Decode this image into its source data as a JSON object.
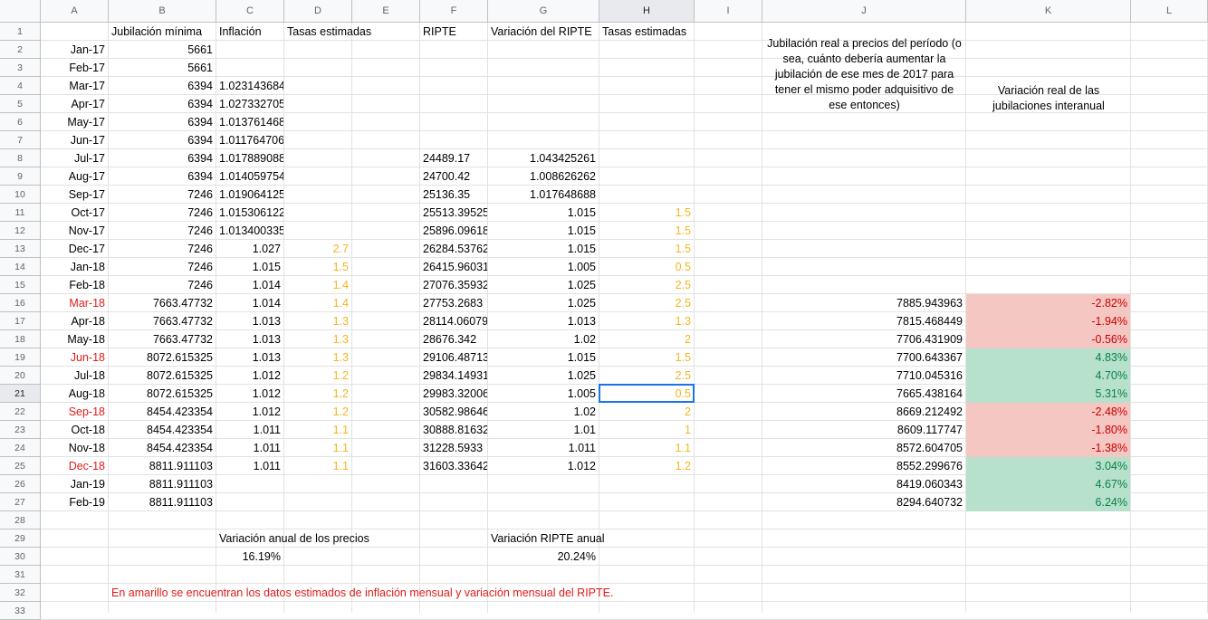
{
  "columns": [
    "A",
    "B",
    "C",
    "D",
    "E",
    "F",
    "G",
    "H",
    "I",
    "J",
    "K",
    "L"
  ],
  "selected_column": "H",
  "selected_row": "21",
  "rows": [
    "1",
    "2",
    "3",
    "4",
    "5",
    "6",
    "7",
    "8",
    "9",
    "10",
    "11",
    "12",
    "13",
    "14",
    "15",
    "16",
    "17",
    "18",
    "19",
    "20",
    "21",
    "22",
    "23",
    "24",
    "25",
    "26",
    "27",
    "28",
    "29",
    "30",
    "31",
    "32",
    "33"
  ],
  "headers": {
    "b": "Jubilación mínima",
    "c": "Inflación",
    "d": "Tasas estimadas",
    "f": "RIPTE",
    "g": "Variación del RIPTE",
    "h": "Tasas estimadas",
    "j": "Jubilación real a precios del período (o sea, cuánto debería aumentar la jubilación de ese mes de 2017 para tener el mismo poder adquisitivo de ese entonces)",
    "k": "Variación real de las jubilaciones interanual"
  },
  "data_rows": [
    {
      "a": "Jan-17",
      "b": "5661",
      "c": "",
      "d": "",
      "f": "",
      "g": "",
      "h": "",
      "j": "",
      "k": ""
    },
    {
      "a": "Feb-17",
      "b": "5661",
      "c": "",
      "d": "",
      "f": "",
      "g": "",
      "h": "",
      "j": "",
      "k": ""
    },
    {
      "a": "Mar-17",
      "b": "6394",
      "c": "1.023143684",
      "d": "",
      "f": "",
      "g": "",
      "h": "",
      "j": "",
      "k": ""
    },
    {
      "a": "Apr-17",
      "b": "6394",
      "c": "1.027332705",
      "d": "",
      "f": "",
      "g": "",
      "h": "",
      "j": "",
      "k": ""
    },
    {
      "a": "May-17",
      "b": "6394",
      "c": "1.013761468",
      "d": "",
      "f": "",
      "g": "",
      "h": "",
      "j": "",
      "k": ""
    },
    {
      "a": "Jun-17",
      "b": "6394",
      "c": "1.011764706",
      "d": "",
      "f": "",
      "g": "",
      "h": "",
      "j": "",
      "k": ""
    },
    {
      "a": "Jul-17",
      "b": "6394",
      "c": "1.017889088",
      "d": "",
      "f": "24489.17",
      "g": "1.043425261",
      "h": "",
      "j": "",
      "k": ""
    },
    {
      "a": "Aug-17",
      "b": "6394",
      "c": "1.014059754",
      "d": "",
      "f": "24700.42",
      "g": "1.008626262",
      "h": "",
      "j": "",
      "k": ""
    },
    {
      "a": "Sep-17",
      "b": "7246",
      "c": "1.019064125",
      "d": "",
      "f": "25136.35",
      "g": "1.017648688",
      "h": "",
      "j": "",
      "k": ""
    },
    {
      "a": "Oct-17",
      "b": "7246",
      "c": "1.015306122",
      "d": "",
      "f": "25513.39525",
      "g": "1.015",
      "h": "1.5",
      "j": "",
      "k": ""
    },
    {
      "a": "Nov-17",
      "b": "7246",
      "c": "1.013400335",
      "d": "",
      "f": "25896.09618",
      "g": "1.015",
      "h": "1.5",
      "j": "",
      "k": ""
    },
    {
      "a": "Dec-17",
      "b": "7246",
      "c": "1.027",
      "d": "2.7",
      "f": "26284.53762",
      "g": "1.015",
      "h": "1.5",
      "j": "",
      "k": ""
    },
    {
      "a": "Jan-18",
      "b": "7246",
      "c": "1.015",
      "d": "1.5",
      "f": "26415.96031",
      "g": "1.005",
      "h": "0.5",
      "j": "",
      "k": ""
    },
    {
      "a": "Feb-18",
      "b": "7246",
      "c": "1.014",
      "d": "1.4",
      "f": "27076.35932",
      "g": "1.025",
      "h": "2.5",
      "j": "",
      "k": ""
    },
    {
      "a": "Mar-18",
      "a_red": true,
      "b": "7663.47732",
      "c": "1.014",
      "d": "1.4",
      "f": "27753.2683",
      "g": "1.025",
      "h": "2.5",
      "j": "7885.943963",
      "k": "-2.82%",
      "k_class": "pink"
    },
    {
      "a": "Apr-18",
      "b": "7663.47732",
      "c": "1.013",
      "d": "1.3",
      "f": "28114.06079",
      "g": "1.013",
      "h": "1.3",
      "j": "7815.468449",
      "k": "-1.94%",
      "k_class": "pink"
    },
    {
      "a": "May-18",
      "b": "7663.47732",
      "c": "1.013",
      "d": "1.3",
      "f": "28676.342",
      "g": "1.02",
      "h": "2",
      "j": "7706.431909",
      "k": "-0.56%",
      "k_class": "pink"
    },
    {
      "a": "Jun-18",
      "a_red": true,
      "b": "8072.615325",
      "c": "1.013",
      "d": "1.3",
      "f": "29106.48713",
      "g": "1.015",
      "h": "1.5",
      "j": "7700.643367",
      "k": "4.83%",
      "k_class": "green"
    },
    {
      "a": "Jul-18",
      "b": "8072.615325",
      "c": "1.012",
      "d": "1.2",
      "f": "29834.14931",
      "g": "1.025",
      "h": "2.5",
      "j": "7710.045316",
      "k": "4.70%",
      "k_class": "green"
    },
    {
      "a": "Aug-18",
      "b": "8072.615325",
      "c": "1.012",
      "d": "1.2",
      "f": "29983.32006",
      "g": "1.005",
      "h": "0.5",
      "j": "7665.438164",
      "k": "5.31%",
      "k_class": "green"
    },
    {
      "a": "Sep-18",
      "a_red": true,
      "b": "8454.423354",
      "c": "1.012",
      "d": "1.2",
      "f": "30582.98646",
      "g": "1.02",
      "h": "2",
      "j": "8669.212492",
      "k": "-2.48%",
      "k_class": "pink"
    },
    {
      "a": "Oct-18",
      "b": "8454.423354",
      "c": "1.011",
      "d": "1.1",
      "f": "30888.81632",
      "g": "1.01",
      "h": "1",
      "j": "8609.117747",
      "k": "-1.80%",
      "k_class": "pink"
    },
    {
      "a": "Nov-18",
      "b": "8454.423354",
      "c": "1.011",
      "d": "1.1",
      "f": "31228.5933",
      "g": "1.011",
      "h": "1.1",
      "j": "8572.604705",
      "k": "-1.38%",
      "k_class": "pink"
    },
    {
      "a": "Dec-18",
      "a_red": true,
      "b": "8811.911103",
      "c": "1.011",
      "d": "1.1",
      "f": "31603.33642",
      "g": "1.012",
      "h": "1.2",
      "j": "8552.299676",
      "k": "3.04%",
      "k_class": "green"
    },
    {
      "a": "Jan-19",
      "b": "8811.911103",
      "c": "",
      "d": "",
      "f": "",
      "g": "",
      "h": "",
      "j": "8419.060343",
      "k": "4.67%",
      "k_class": "green"
    },
    {
      "a": "Feb-19",
      "b": "8811.911103",
      "c": "",
      "d": "",
      "f": "",
      "g": "",
      "h": "",
      "j": "8294.640732",
      "k": "6.24%",
      "k_class": "green"
    }
  ],
  "summary": {
    "annual_price_label": "Variación anual de los precios",
    "annual_price_value": "16.19%",
    "ripte_label": "Variación RIPTE anual",
    "ripte_value": "20.24%"
  },
  "note": "En amarillo se encuentran los datos estimados de inflación mensual y variación mensual del RIPTE.",
  "colors": {
    "red_text": "#e01b1b",
    "yellow_text": "#f3b61f",
    "negative_fill": "#f4c7c3",
    "positive_fill": "#b7e1cd",
    "selection": "#1a73e8"
  }
}
